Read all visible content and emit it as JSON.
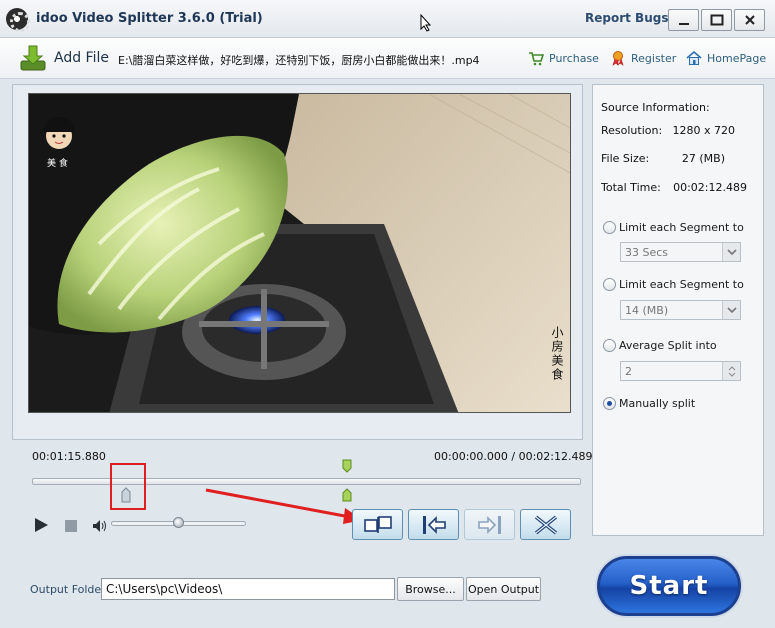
{
  "window": {
    "title": "idoo Video Splitter 3.6.0 (Trial)",
    "report_bugs": "Report Bugs",
    "controls": {
      "minimize": "minimize-icon",
      "maximize": "maximize-icon",
      "close": "close-icon"
    }
  },
  "toolbar": {
    "add_file": "Add File",
    "file_name": "E:\\腊溜白菜这样做，好吃到爆，还特别下饭，厨房小白都能做出来！.mp4",
    "purchase": "Purchase",
    "register": "Register",
    "homepage": "HomePage"
  },
  "video": {
    "watermark_vertical": "小房美食",
    "logo_text": "美 食"
  },
  "source_info": {
    "heading": "Source Information:",
    "resolution_label": "Resolution:",
    "resolution_value": "1280 x 720",
    "filesize_label": "File Size:",
    "filesize_value": "27 (MB)",
    "totaltime_label": "Total Time:",
    "totaltime_value": "00:02:12.489"
  },
  "split_options": {
    "by_time_label": "Limit each Segment to",
    "by_time_value": "33 Secs",
    "by_size_label": "Limit each Segment to",
    "by_size_value": "14 (MB)",
    "average_label": "Average Split into",
    "average_value": "2",
    "manual_label": "Manually split",
    "selected": "manual"
  },
  "timeline": {
    "current_time": "00:01:15.880",
    "range": "00:00:00.000 / 00:02:12.489",
    "cursor_position": 0.573,
    "split_marker_position": 0.171
  },
  "player": {
    "volume": 0.5
  },
  "tool_buttons": {
    "add_split": "add-split-marker-icon",
    "set_start": "set-start-icon",
    "set_end": "set-end-icon",
    "delete": "delete-marker-icon"
  },
  "output": {
    "label": "Output Folder:",
    "path": "C:\\Users\\pc\\Videos\\",
    "browse": "Browse...",
    "open_output": "Open Output"
  },
  "start": {
    "label": "Start"
  },
  "colors": {
    "accent": "#1f4f9c",
    "annotation": "#e02020",
    "marker_green": "#8cc63f"
  }
}
